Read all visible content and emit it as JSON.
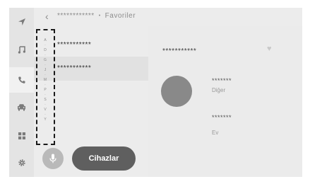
{
  "header": {
    "title": "************",
    "separator": "•",
    "tab": "Favoriler"
  },
  "nav": {
    "items": [
      "navigation-icon",
      "music-icon",
      "phone-icon",
      "car-icon",
      "apps-icon",
      "settings-icon"
    ],
    "active_index": 2
  },
  "contacts": [
    {
      "name": "***********"
    },
    {
      "name": "***********"
    }
  ],
  "alphabet_index": [
    "A",
    "·",
    "D",
    "·",
    "G",
    "·",
    "J",
    "·",
    "M",
    "·",
    "P",
    "·",
    "S",
    "·",
    "V",
    "·",
    "Y"
  ],
  "detail": {
    "name": "***********",
    "numbers": [
      {
        "number": "*******",
        "label": "Diğer"
      },
      {
        "number": "*******",
        "label": "Ev"
      }
    ]
  },
  "bottom": {
    "mic_icon": "microphone-icon",
    "devices_label": "Cihazlar"
  },
  "colors": {
    "screen_bg": "#ececec",
    "nav_bg": "#e4e4e4",
    "button_dark": "#5f5f5f",
    "avatar": "#898989",
    "highlight_border": "#1a1a1a"
  }
}
